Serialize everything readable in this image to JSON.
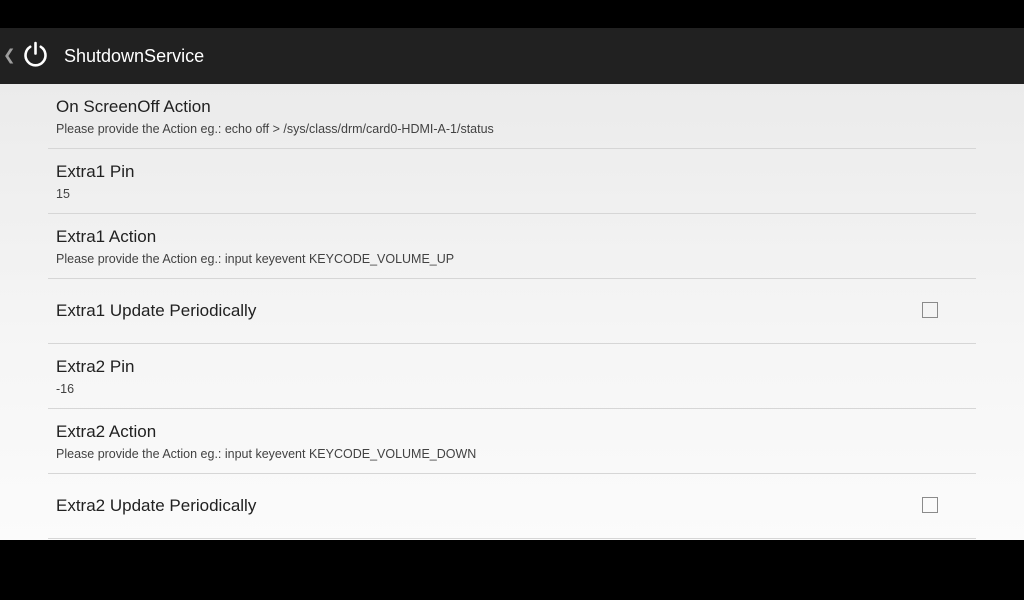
{
  "action_bar": {
    "title": "ShutdownService",
    "up_icon": "chevron-left-icon",
    "app_icon": "power-icon"
  },
  "preferences": [
    {
      "title": "On ScreenOff Action",
      "summary": "Please provide the Action eg.: echo off > /sys/class/drm/card0-HDMI-A-1/status"
    },
    {
      "title": "Extra1 Pin",
      "summary": "15"
    },
    {
      "title": "Extra1 Action",
      "summary": "Please provide the Action eg.: input keyevent KEYCODE_VOLUME_UP"
    },
    {
      "title": "Extra1 Update Periodically",
      "checked": false
    },
    {
      "title": "Extra2 Pin",
      "summary": "-16"
    },
    {
      "title": "Extra2 Action",
      "summary": "Please provide the Action eg.: input keyevent KEYCODE_VOLUME_DOWN"
    },
    {
      "title": "Extra2 Update Periodically",
      "checked": false
    }
  ]
}
